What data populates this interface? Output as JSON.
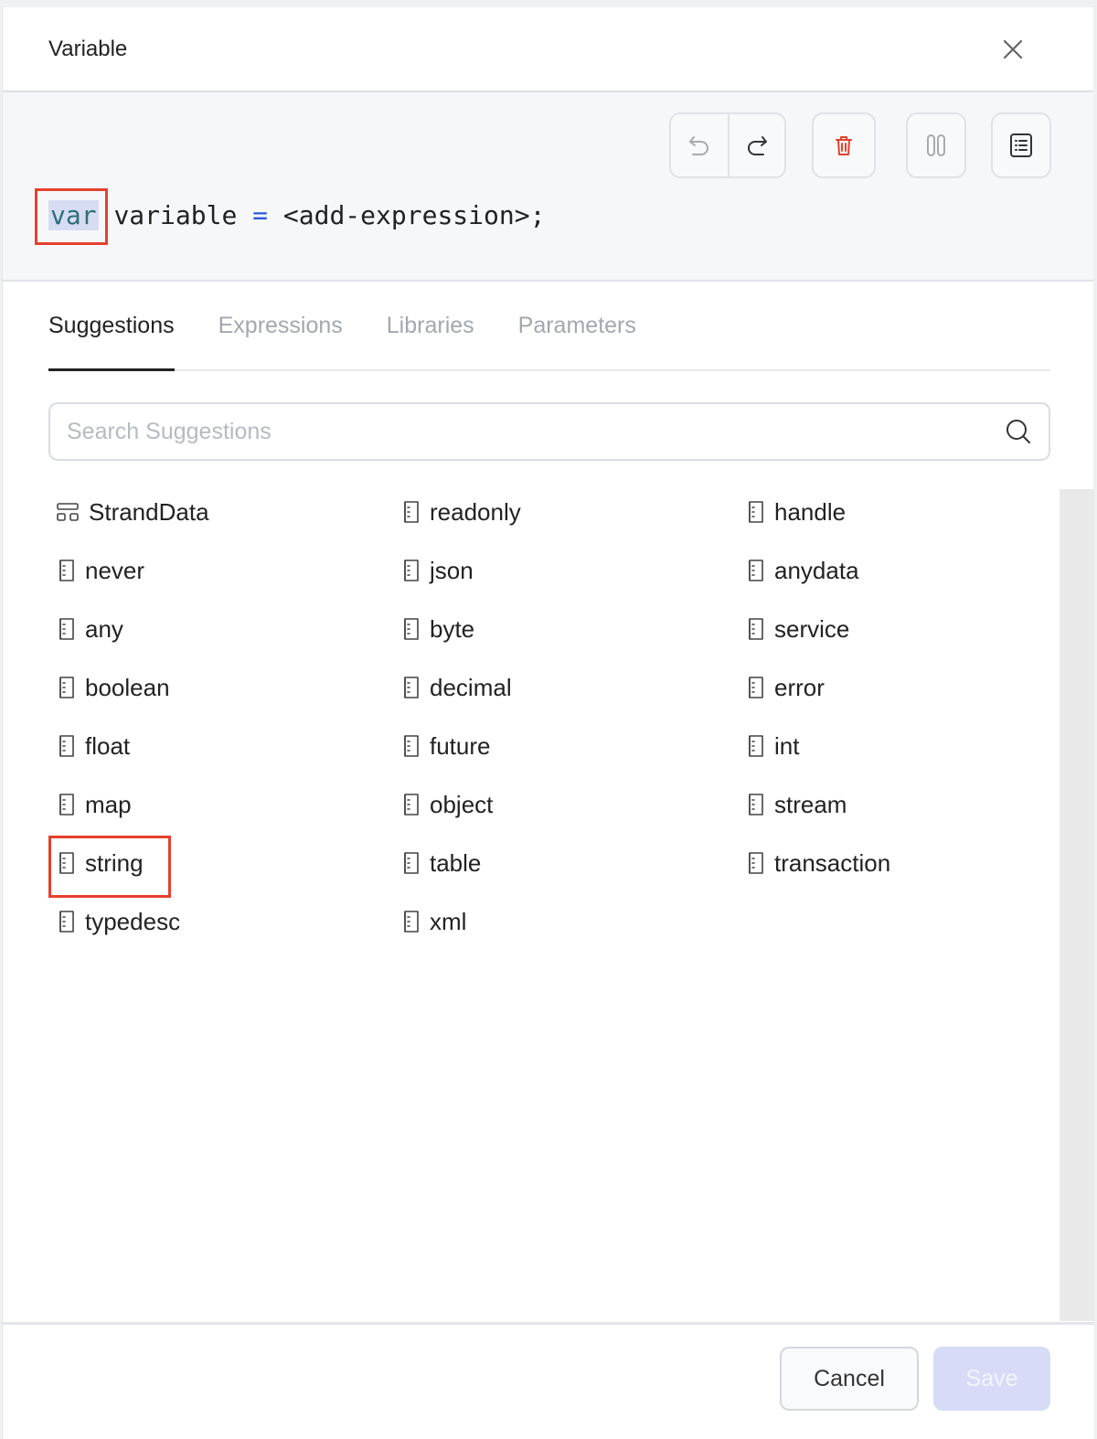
{
  "header": {
    "title": "Variable"
  },
  "editor": {
    "code": {
      "keyword": "var",
      "name": "variable",
      "operator": "=",
      "expression": "<add-expression>",
      "terminator": ";"
    }
  },
  "tabs": [
    {
      "label": "Suggestions",
      "active": true
    },
    {
      "label": "Expressions",
      "active": false
    },
    {
      "label": "Libraries",
      "active": false
    },
    {
      "label": "Parameters",
      "active": false
    }
  ],
  "search": {
    "placeholder": "Search Suggestions"
  },
  "suggestions": {
    "columns": [
      [
        "StrandData",
        "never",
        "any",
        "boolean",
        "float",
        "map",
        "string",
        "typedesc"
      ],
      [
        "readonly",
        "json",
        "byte",
        "decimal",
        "future",
        "object",
        "table",
        "xml"
      ],
      [
        "handle",
        "anydata",
        "service",
        "error",
        "int",
        "stream",
        "transaction"
      ]
    ]
  },
  "footer": {
    "cancel_label": "Cancel",
    "save_label": "Save"
  },
  "colors": {
    "highlight": "#e5412d",
    "delete_icon": "#e5412d",
    "save_disabled": "#d7dbf7"
  }
}
